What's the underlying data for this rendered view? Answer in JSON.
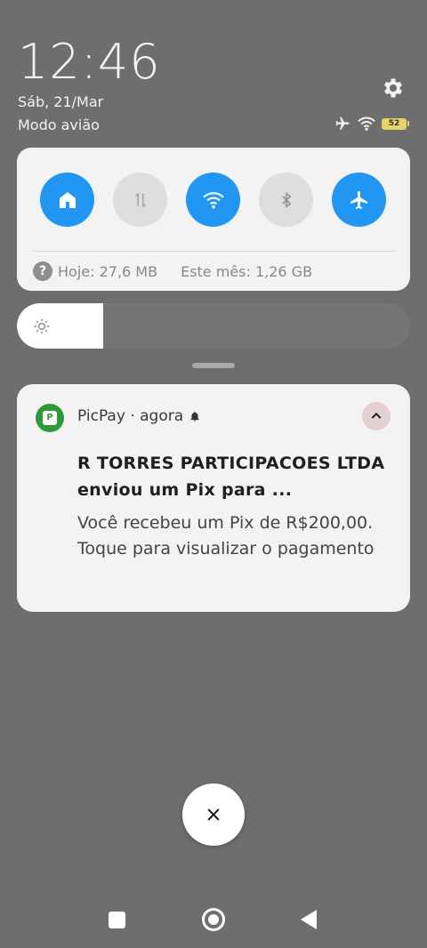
{
  "status": {
    "time": "12:46",
    "date": "Sáb, 21/Mar",
    "mode": "Modo avião",
    "battery_level": "52"
  },
  "quick_settings": {
    "toggles": [
      {
        "name": "home",
        "icon": "home-icon",
        "state": "on"
      },
      {
        "name": "mobile-data",
        "icon": "data-arrows-icon",
        "state": "off"
      },
      {
        "name": "wifi",
        "icon": "wifi-icon",
        "state": "on"
      },
      {
        "name": "bluetooth",
        "icon": "bluetooth-icon",
        "state": "off"
      },
      {
        "name": "airplane",
        "icon": "airplane-icon",
        "state": "on"
      }
    ],
    "usage_today": "Hoje: 27,6 MB",
    "usage_month": "Este mês: 1,26 GB",
    "help_glyph": "?"
  },
  "brightness": {
    "level_fraction": 0.22
  },
  "notification": {
    "app_icon_text": "P",
    "app_line": "PicPay · agora",
    "title": "R TORRES PARTICIPACOES LTDA enviou um Pix para ...",
    "body": "Você recebeu um Pix de R$200,00. Toque para visualizar o pagamento"
  },
  "colors": {
    "accent": "#2196f3",
    "background": "#6e6e6e",
    "picpay_green": "#2e9a3a"
  }
}
